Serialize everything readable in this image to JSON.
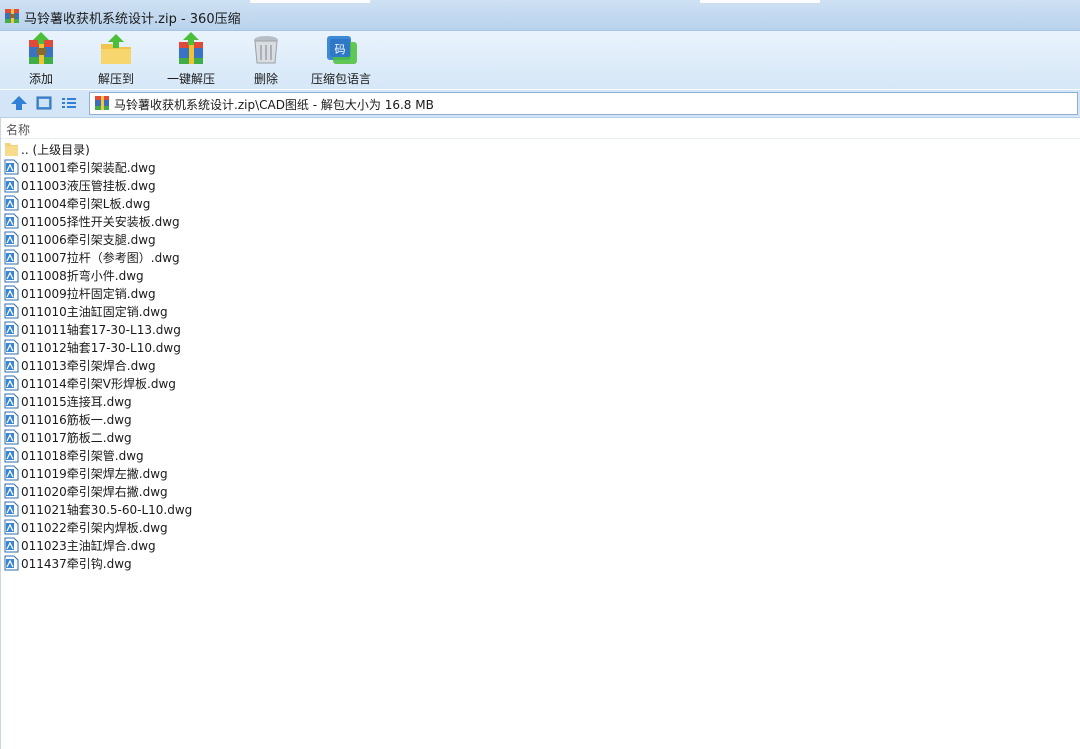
{
  "window": {
    "title": "马铃薯收获机系统设计.zip - 360压缩"
  },
  "toolbar": [
    {
      "label": "添加",
      "icon": "add-archive-icon"
    },
    {
      "label": "解压到",
      "icon": "extract-to-folder-icon"
    },
    {
      "label": "一键解压",
      "icon": "one-click-extract-icon"
    },
    {
      "label": "删除",
      "icon": "trash-icon"
    },
    {
      "label": "压缩包语言",
      "icon": "language-code-icon"
    }
  ],
  "address": {
    "path": "马铃薯收获机系统设计.zip\\CAD图纸 - 解包大小为 16.8 MB"
  },
  "list": {
    "column_name": "名称",
    "parent": ".. (上级目录)",
    "files": [
      "011001牵引架装配.dwg",
      "011003液压管挂板.dwg",
      "011004牵引架L板.dwg",
      "011005择性开关安装板.dwg",
      "011006牵引架支腿.dwg",
      "011007拉杆（参考图）.dwg",
      "011008折弯小件.dwg",
      "011009拉杆固定销.dwg",
      "011010主油缸固定销.dwg",
      "011011轴套17-30-L13.dwg",
      "011012轴套17-30-L10.dwg",
      "011013牵引架焊合.dwg",
      "011014牵引架V形焊板.dwg",
      "011015连接耳.dwg",
      "011016筋板一.dwg",
      "011017筋板二.dwg",
      "011018牵引架管.dwg",
      "011019牵引架焊左撇.dwg",
      "011020牵引架焊右撇.dwg",
      "011021轴套30.5-60-L10.dwg",
      "011022牵引架内焊板.dwg",
      "011023主油缸焊合.dwg",
      "011437牵引钩.dwg"
    ]
  },
  "colors": {
    "titlebar": "#c4daf0",
    "toolbar": "#e1eefa",
    "address_bar": "#d3e5f7"
  }
}
